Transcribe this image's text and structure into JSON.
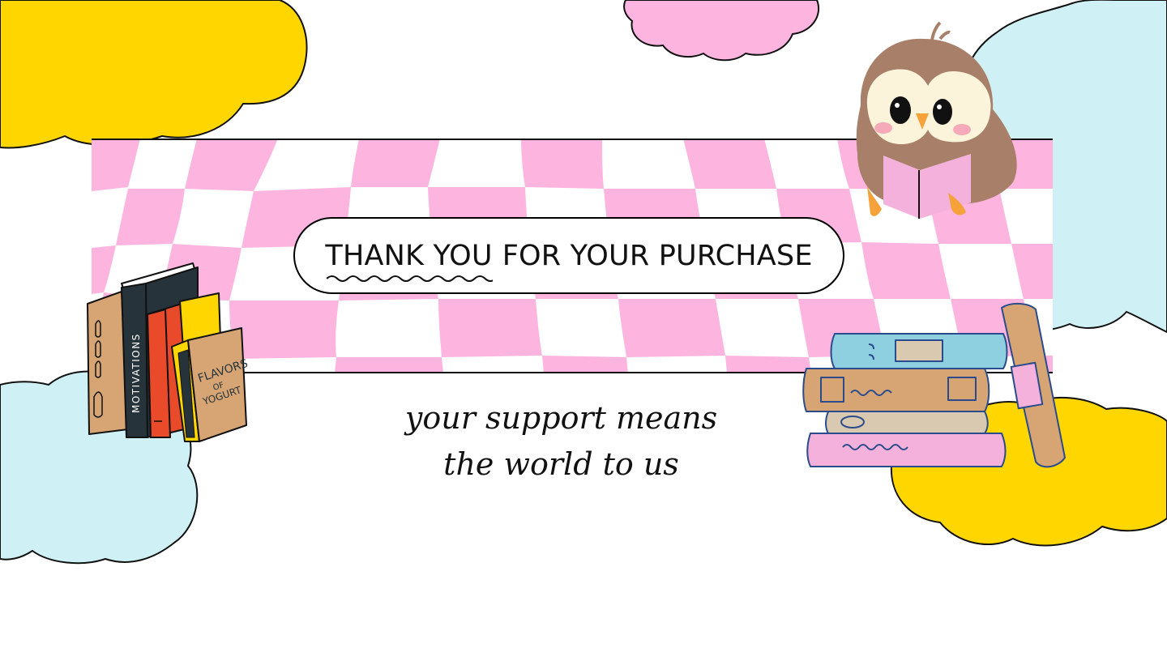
{
  "card": {
    "title_highlight": "THANK YOU",
    "title_rest": "FOR YOUR PURCHASE",
    "tagline_line1": "your support means",
    "tagline_line2": "the world to us"
  },
  "book_covers": {
    "motivations": "MOTIVATIONS",
    "flavors_1": "FLAVORS",
    "flavors_2": "OF",
    "flavors_3": "YOGURT"
  },
  "colors": {
    "pink": "#FDB4DF",
    "yellow": "#FFD600",
    "light_blue": "#CFF0F4",
    "outline": "#111111"
  },
  "icons": [
    "cloud-icon",
    "owl-icon",
    "book-icon"
  ]
}
